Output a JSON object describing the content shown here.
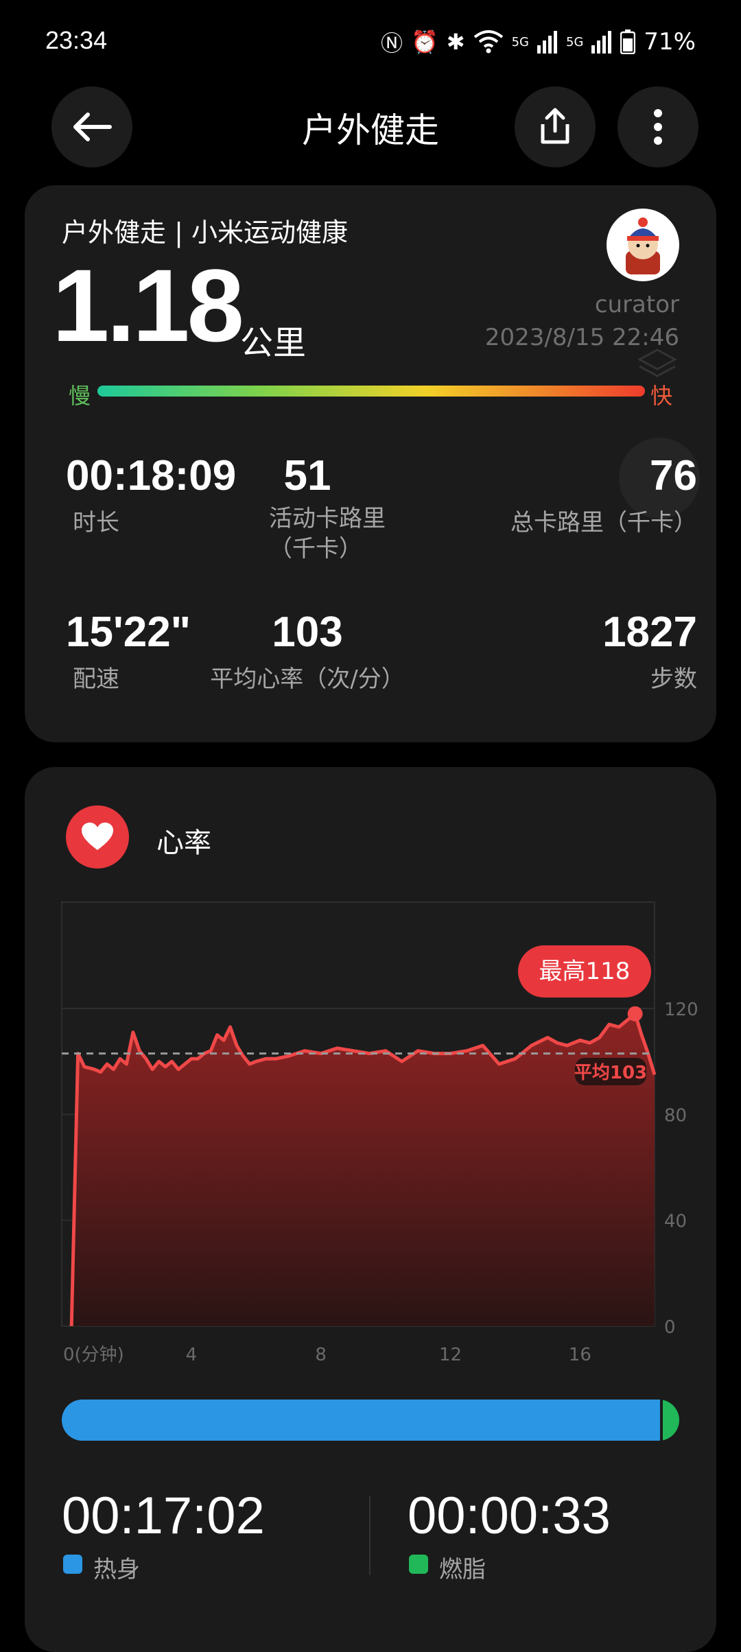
{
  "status_bar": {
    "time": "23:34",
    "battery": "71%",
    "network": "5G"
  },
  "header": {
    "title": "户外健走"
  },
  "summary": {
    "source": "户外健走 | 小米运动健康",
    "distance": "1.18",
    "distance_unit": "公里",
    "user": "curator",
    "datetime": "2023/8/15 22:46",
    "pace_slow": "慢",
    "pace_fast": "快",
    "stats": [
      {
        "value": "00:18:09",
        "label": "时长"
      },
      {
        "value": "51",
        "label": "活动卡路里（千卡）"
      },
      {
        "value": "76",
        "label": "总卡路里（千卡）"
      },
      {
        "value": "15'22\"",
        "label": "配速"
      },
      {
        "value": "103",
        "label": "平均心率（次/分）"
      },
      {
        "value": "1827",
        "label": "步数"
      }
    ]
  },
  "heart": {
    "title": "心率",
    "max_label": "最高118",
    "avg_label": "平均103",
    "y_ticks": [
      "120",
      "80",
      "40",
      "0"
    ],
    "x_ticks": [
      "0(分钟)",
      "4",
      "8",
      "12",
      "16"
    ],
    "zones": [
      {
        "time": "00:17:02",
        "label": "热身",
        "color": "#2b96e3"
      },
      {
        "time": "00:00:33",
        "label": "燃脂",
        "color": "#20b858"
      }
    ]
  },
  "chart_data": {
    "type": "area",
    "title": "心率",
    "xlabel": "0(分钟)",
    "ylabel": "",
    "xlim": [
      0,
      18.3
    ],
    "ylim": [
      0,
      120
    ],
    "grid": true,
    "avg": 103,
    "max": 118,
    "x": [
      0.3,
      0.5,
      0.7,
      1.0,
      1.2,
      1.4,
      1.6,
      1.8,
      2.0,
      2.2,
      2.4,
      2.6,
      2.8,
      3.0,
      3.2,
      3.4,
      3.6,
      3.8,
      4.0,
      4.2,
      4.4,
      4.6,
      4.8,
      5.0,
      5.2,
      5.4,
      5.6,
      5.8,
      6.0,
      6.3,
      6.6,
      7.0,
      7.5,
      8.0,
      8.5,
      9.0,
      9.5,
      10.0,
      10.5,
      11.0,
      11.5,
      12.0,
      12.5,
      13.0,
      13.5,
      14.0,
      14.5,
      15.0,
      15.3,
      15.6,
      16.0,
      16.3,
      16.6,
      16.9,
      17.2,
      17.5,
      17.7,
      17.9,
      18.1,
      18.3
    ],
    "values": [
      0,
      103,
      98,
      97,
      96,
      99,
      97,
      101,
      99,
      111,
      104,
      101,
      97,
      100,
      98,
      100,
      97,
      99,
      101,
      101,
      103,
      104,
      110,
      108,
      113,
      106,
      102,
      99,
      100,
      101,
      101,
      102,
      104,
      103,
      105,
      104,
      103,
      104,
      100,
      104,
      103,
      103,
      104,
      106,
      99,
      101,
      106,
      109,
      107,
      106,
      108,
      107,
      109,
      114,
      113,
      116,
      118,
      110,
      103,
      95
    ]
  }
}
